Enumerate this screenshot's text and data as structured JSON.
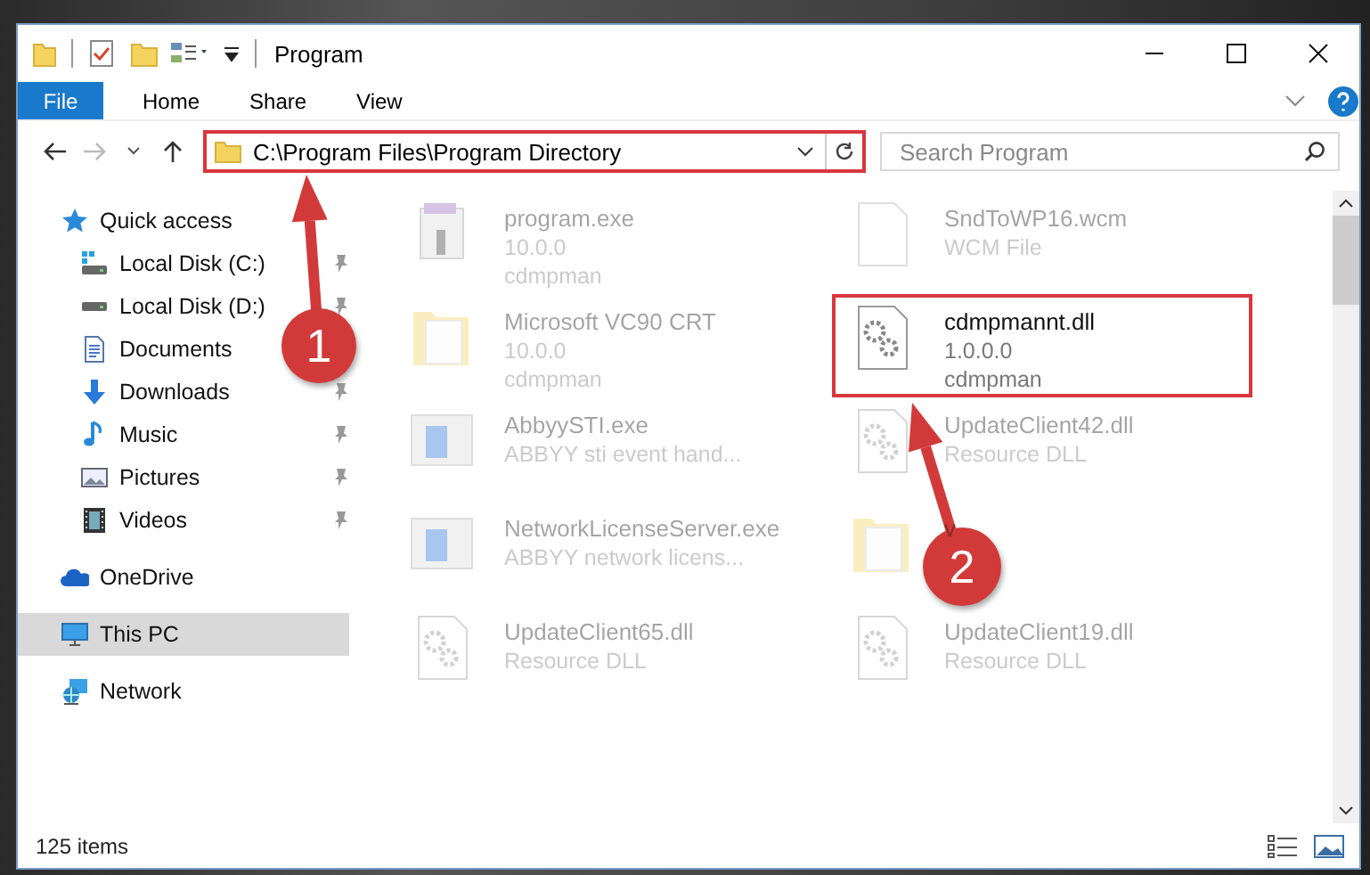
{
  "window": {
    "title": "Program"
  },
  "ribbon_tabs": [
    {
      "label": "File",
      "kind": "file"
    },
    {
      "label": "Home",
      "kind": "tab"
    },
    {
      "label": "Share",
      "kind": "tab"
    },
    {
      "label": "View",
      "kind": "tab"
    }
  ],
  "address_bar": {
    "path": "C:\\Program Files\\Program Directory",
    "highlighted": true
  },
  "search": {
    "placeholder": "Search Program"
  },
  "nav": [
    {
      "label": "Quick access",
      "kind": "star",
      "selected": false,
      "children": [
        {
          "label": "Local Disk (C:)",
          "kind": "disk-win",
          "selected": false,
          "pinned": true
        },
        {
          "label": "Local Disk (D:)",
          "kind": "disk",
          "selected": false,
          "pinned": true
        },
        {
          "label": "Documents",
          "kind": "docs",
          "selected": false
        },
        {
          "label": "Downloads",
          "kind": "download",
          "selected": false,
          "pinned": true
        },
        {
          "label": "Music",
          "kind": "music",
          "selected": false,
          "pinned": true
        },
        {
          "label": "Pictures",
          "kind": "pictures",
          "selected": false,
          "pinned": true
        },
        {
          "label": "Videos",
          "kind": "videos",
          "selected": false,
          "pinned": true
        }
      ]
    },
    {
      "label": "OneDrive",
      "kind": "cloud",
      "selected": false
    },
    {
      "label": "This PC",
      "kind": "pc",
      "selected": true
    },
    {
      "label": "Network",
      "kind": "network",
      "selected": false
    }
  ],
  "files": [
    {
      "name": "program.exe",
      "details": [
        "10.0.0",
        "cdmpman"
      ],
      "kind": "app",
      "faded": true,
      "highlighted": false
    },
    {
      "name": "SndToWP16.wcm",
      "details": [
        "WCM File"
      ],
      "kind": "doc",
      "faded": true,
      "highlighted": false
    },
    {
      "name": "Microsoft VC90 CRT",
      "details": [
        "10.0.0",
        "cdmpman"
      ],
      "kind": "folder",
      "faded": true,
      "highlighted": false
    },
    {
      "name": "cdmpmannt.dll",
      "details": [
        "1.0.0.0",
        "cdmpman"
      ],
      "kind": "gear",
      "faded": false,
      "highlighted": true
    },
    {
      "name": "AbbyySTI.exe",
      "details": [
        "ABBYY sti event hand..."
      ],
      "kind": "window",
      "faded": true,
      "highlighted": false
    },
    {
      "name": "UpdateClient42.dll",
      "details": [
        "Resource DLL"
      ],
      "kind": "gear",
      "faded": true,
      "highlighted": false
    },
    {
      "name": "NetworkLicenseServer.exe",
      "details": [
        "ABBYY network licens..."
      ],
      "kind": "window",
      "faded": true,
      "highlighted": false
    },
    {
      "name": "v",
      "kind": "folder",
      "faded": true,
      "highlighted": false
    },
    {
      "name": "UpdateClient65.dll",
      "details": [
        "Resource DLL"
      ],
      "kind": "gear",
      "faded": true,
      "highlighted": false
    },
    {
      "name": "UpdateClient19.dll",
      "details": [
        "Resource DLL"
      ],
      "kind": "gear",
      "faded": true,
      "highlighted": false
    }
  ],
  "status_bar": {
    "count": "125 items"
  },
  "markers": [
    {
      "number": "1"
    },
    {
      "number": "2"
    }
  ]
}
